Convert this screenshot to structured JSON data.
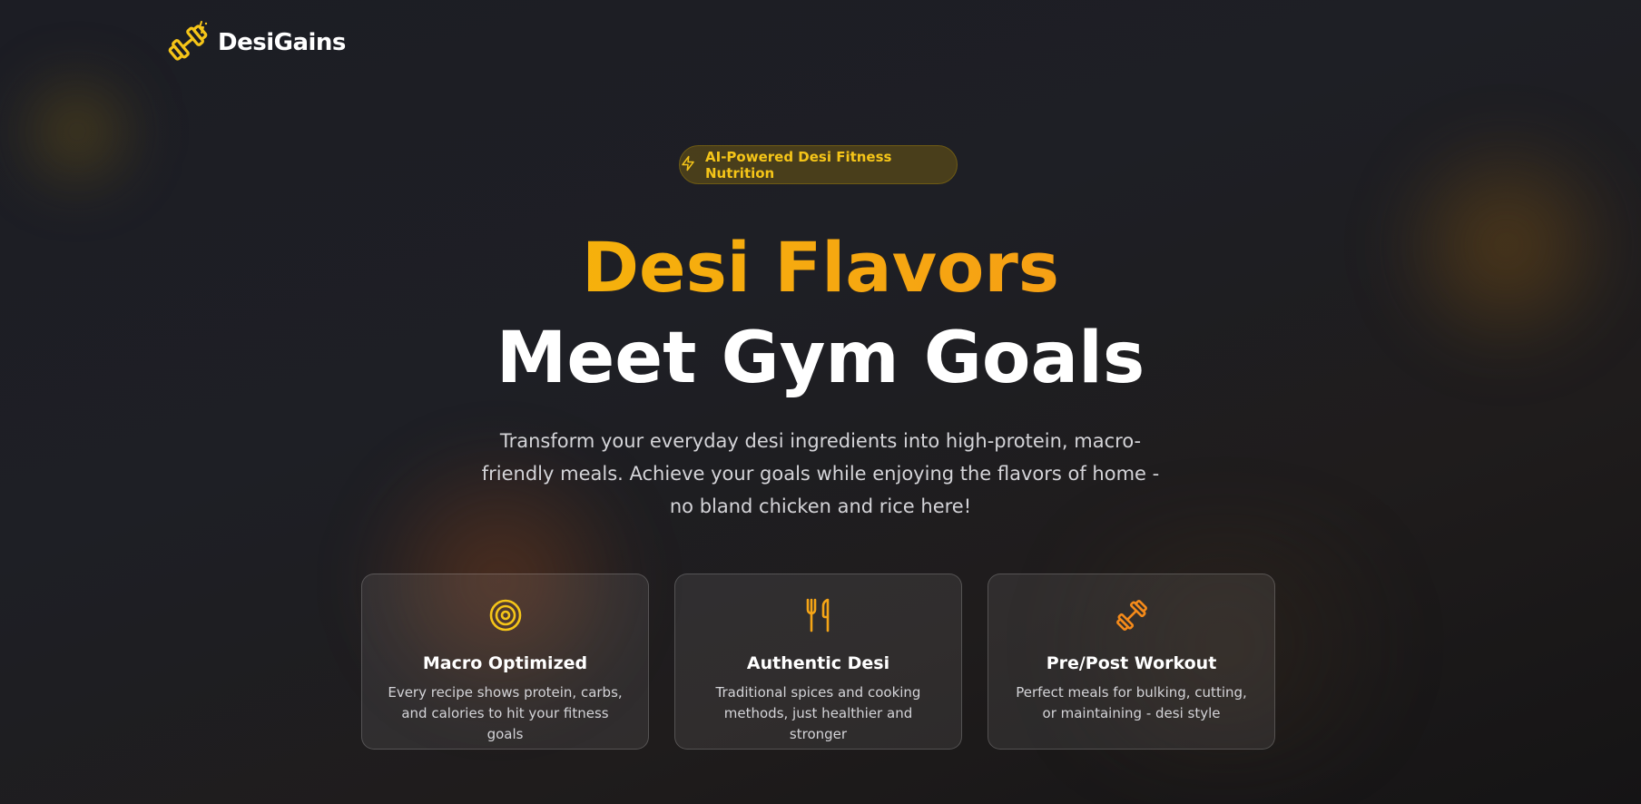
{
  "brand": {
    "name": "DesiGains",
    "logo_icon": "dumbbell-icon"
  },
  "badge": {
    "icon": "lightning-icon",
    "label": "AI-Powered Desi Fitness Nutrition"
  },
  "hero": {
    "title_line1": "Desi Flavors",
    "title_line2": "Meet Gym Goals",
    "subtitle": "Transform your everyday desi ingredients into high-protein, macro-friendly meals. Achieve your goals while enjoying the flavors of home - no bland chicken and rice here!"
  },
  "features": [
    {
      "icon": "target-icon",
      "title": "Macro Optimized",
      "description": "Every recipe shows protein, carbs, and calories to hit your fitness goals"
    },
    {
      "icon": "utensils-icon",
      "title": "Authentic Desi",
      "description": "Traditional spices and cooking methods, just healthier and stronger"
    },
    {
      "icon": "dumbbell-icon",
      "title": "Pre/Post Workout",
      "description": "Perfect meals for bulking, cutting, or maintaining - desi style"
    }
  ],
  "colors": {
    "accent_yellow": "#f5c518",
    "accent_orange": "#f48a1a",
    "background": "#1e1f25"
  }
}
